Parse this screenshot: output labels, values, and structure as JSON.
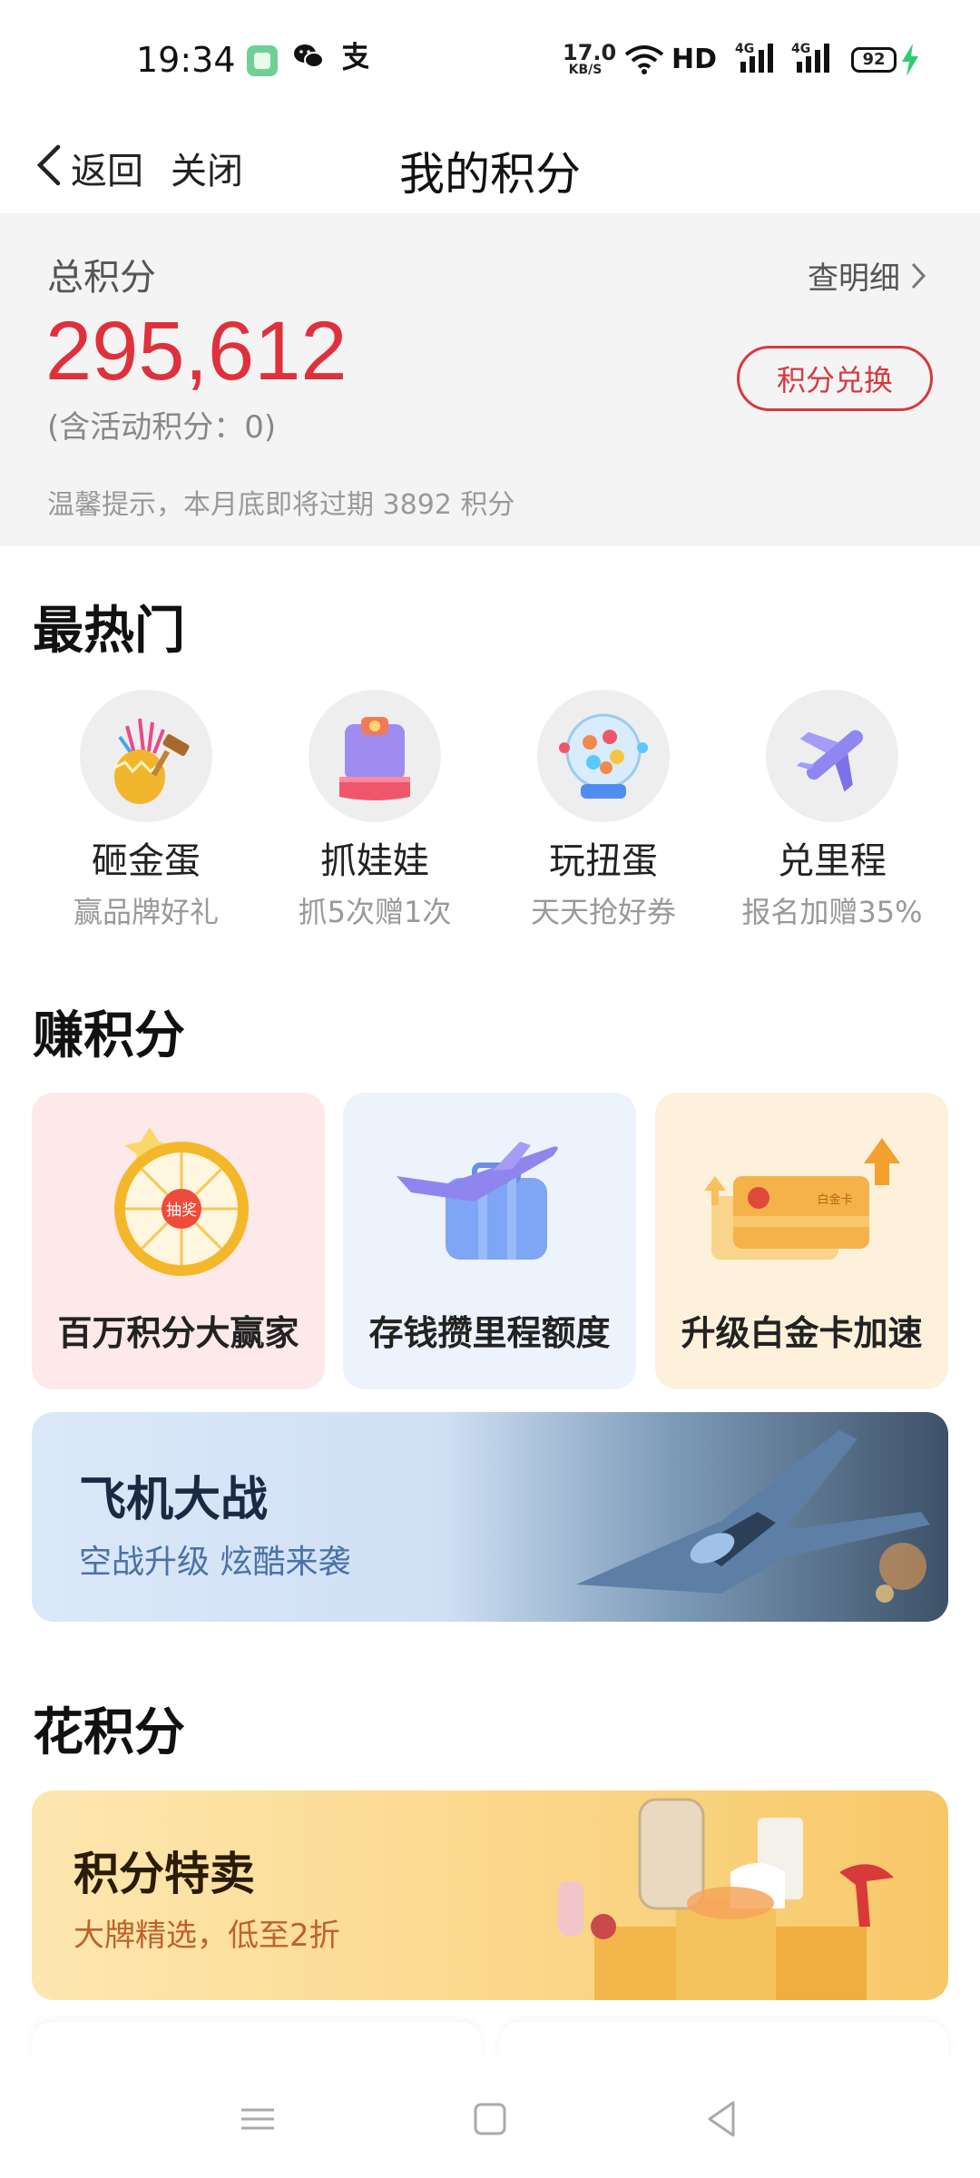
{
  "status_bar": {
    "time": "19:34",
    "speed_value": "17.0",
    "speed_unit": "KB/S",
    "hd_label": "HD",
    "network_1": "4G",
    "network_2": "4G",
    "battery": "92",
    "icons": [
      "app-icon",
      "wechat-icon",
      "alipay-icon",
      "wifi-icon",
      "signal-icon",
      "battery-icon",
      "charging-icon"
    ]
  },
  "nav": {
    "back_label": "返回",
    "close_label": "关闭",
    "title": "我的积分"
  },
  "summary": {
    "label": "总积分",
    "detail_link": "查明细",
    "total": "295,612",
    "activity_note": "(含活动积分：0)",
    "exchange_button": "积分兑换",
    "tip": "温馨提示，本月底即将过期 3892 积分"
  },
  "hot": {
    "title": "最热门",
    "items": [
      {
        "name": "砸金蛋",
        "sub": "赢品牌好礼",
        "icon": "golden-egg-icon"
      },
      {
        "name": "抓娃娃",
        "sub": "抓5次赠1次",
        "icon": "claw-machine-icon"
      },
      {
        "name": "玩扭蛋",
        "sub": "天天抢好券",
        "icon": "gashapon-icon"
      },
      {
        "name": "兑里程",
        "sub": "报名加赠35%",
        "icon": "airplane-icon"
      }
    ]
  },
  "earn": {
    "title": "赚积分",
    "cards": [
      {
        "label": "百万积分大赢家",
        "icon": "prize-wheel-icon"
      },
      {
        "label": "存钱攒里程额度",
        "icon": "plane-suitcase-icon"
      },
      {
        "label": "升级白金卡加速",
        "icon": "platinum-card-icon",
        "card_text": "白金卡"
      }
    ],
    "wheel_center": "抽奖",
    "banner": {
      "title": "飞机大战",
      "subtitle": "空战升级  炫酷来袭"
    }
  },
  "spend": {
    "title": "花积分",
    "banner": {
      "title": "积分特卖",
      "subtitle": "大牌精选，低至2折"
    }
  },
  "colors": {
    "accent": "#e0303c",
    "summary_bg": "#f4f4f4",
    "card_pink": "#fde8ea",
    "card_blue": "#edf3fd",
    "card_yellow": "#fdf1dc"
  }
}
